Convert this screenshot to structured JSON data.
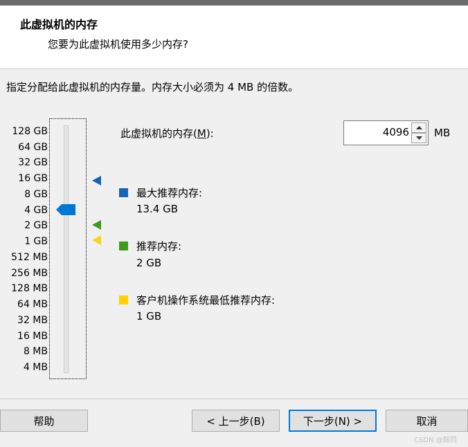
{
  "header": {
    "title": "此虚拟机的内存",
    "subtitle": "您要为此虚拟机使用多少内存?"
  },
  "instruction": "指定分配给此虚拟机的内存量。内存大小必须为 4 MB 的倍数。",
  "slider": {
    "scale": [
      "128 GB",
      "64 GB",
      "32 GB",
      "16 GB",
      "8 GB",
      "4 GB",
      "2 GB",
      "1 GB",
      "512 MB",
      "256 MB",
      "128 MB",
      "64 MB",
      "32 MB",
      "16 MB",
      "8 MB",
      "4 MB"
    ],
    "current_value": "4 GB",
    "markers": [
      {
        "name": "max-recommended",
        "value": "16 GB",
        "color": "#1565b3"
      },
      {
        "name": "recommended",
        "value": "2 GB",
        "color": "#3c9a1f"
      },
      {
        "name": "guest-os-min",
        "value": "1 GB",
        "color": "#f7d51a"
      }
    ]
  },
  "memory": {
    "label_prefix": "此虚拟机的内存(",
    "label_mnemonic": "M",
    "label_suffix": "):",
    "value": "4096",
    "unit": "MB"
  },
  "legend": [
    {
      "title": "最大推荐内存:",
      "value": "13.4 GB",
      "color": "#1565b3"
    },
    {
      "title": "推荐内存:",
      "value": "2 GB",
      "color": "#3c9a1f"
    },
    {
      "title": "客户机操作系统最低推荐内存:",
      "value": "1 GB",
      "color": "#ffd200"
    }
  ],
  "buttons": {
    "help": "帮助",
    "back": "< 上一步(B)",
    "next": "下一步(N) >",
    "cancel": "取消"
  },
  "watermark": "CSDN @懿同"
}
